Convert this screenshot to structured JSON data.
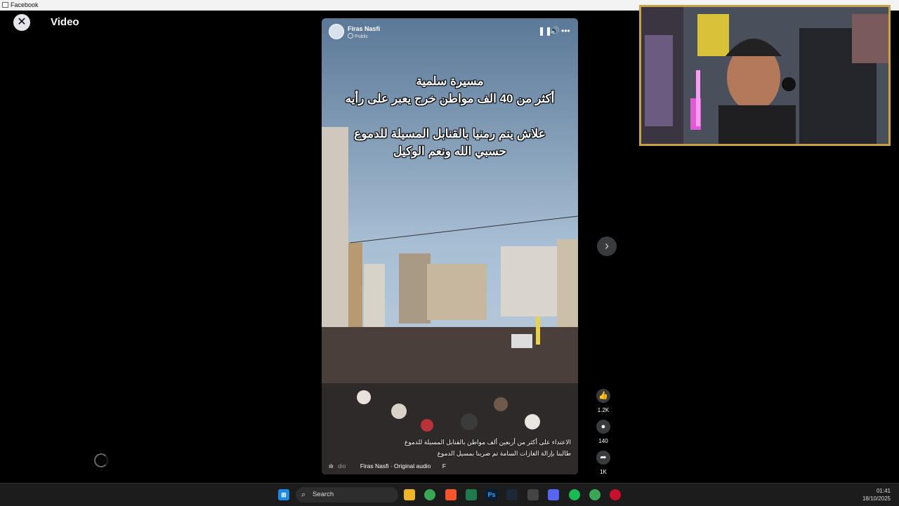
{
  "window": {
    "title": "Facebook"
  },
  "viewer": {
    "close_icon": "close-icon",
    "title": "Video"
  },
  "post": {
    "author": "Firas Nasfi",
    "privacy": "Public",
    "overlay_lines_1": [
      "مسيرة سلمية",
      "أكثر من 40 الف مواطن خرج يعبر على رأيه"
    ],
    "overlay_lines_2": [
      "علاش يتم رمنيا بالقنابل المسيلة للدموع",
      "حسبي الله ونعم الوكيل"
    ],
    "caption_line_1": "الاعتداء على أكثر من أربعين ألف مواطن بالقنابل المسيلة للدموع",
    "caption_line_2": "طالبنا بإزالة الغازات السامة تم ضربنا بمسيل الدموع",
    "audio": "Firas Nasfi · Original audio",
    "audio_suffix": "F",
    "audio_left": "dio"
  },
  "actions": {
    "likes": "1.2K",
    "comments": "140",
    "shares": "1K"
  },
  "taskbar": {
    "search_placeholder": "Search",
    "time": "01:41",
    "date": "18/10/2025"
  },
  "colors": {
    "accent": "#c8a24a",
    "background": "#000000"
  }
}
